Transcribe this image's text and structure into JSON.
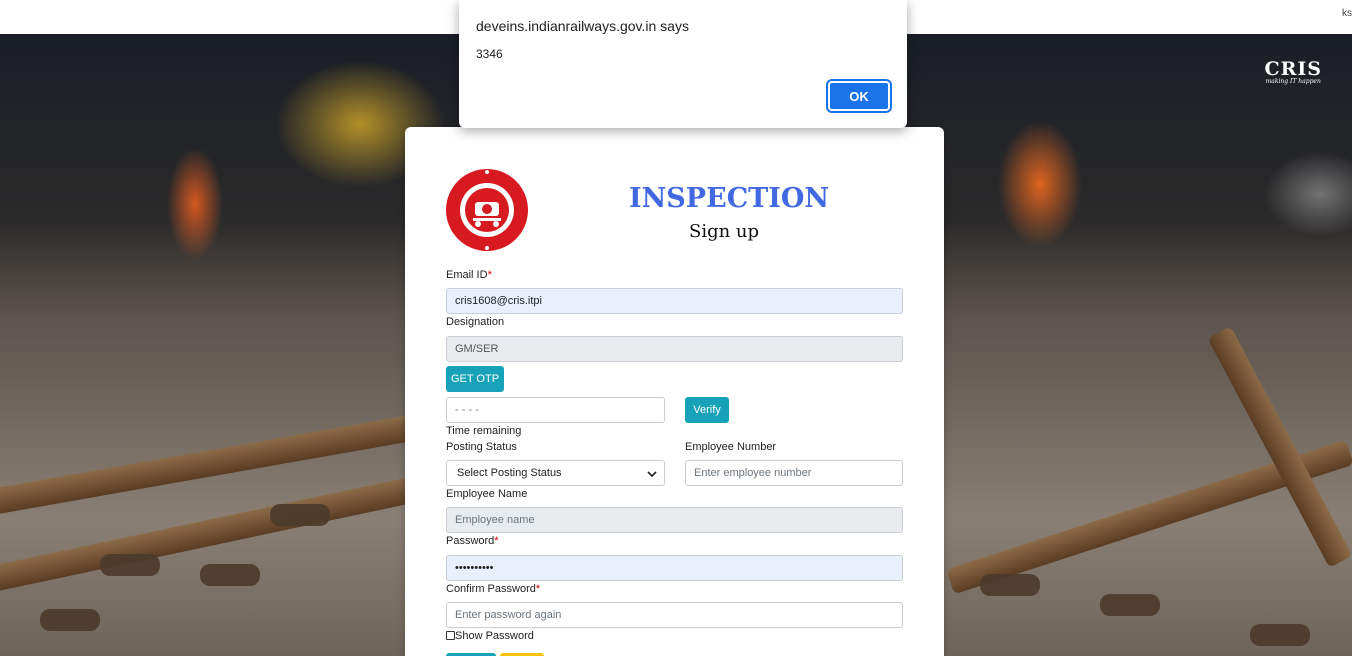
{
  "browser": {
    "edge_text": "ks"
  },
  "dialog": {
    "title": "deveins.indianrailways.gov.in says",
    "message": "3346",
    "ok_label": "OK"
  },
  "logo": {
    "name": "CRIS",
    "tagline": "making IT happen"
  },
  "form": {
    "title": "INSPECTION",
    "subtitle": "Sign up",
    "email": {
      "label": "Email ID",
      "required_mark": "*",
      "value": "cris1608@cris.itpi"
    },
    "designation": {
      "label": "Designation",
      "value": "GM/SER"
    },
    "get_otp_label": "GET OTP",
    "otp": {
      "value": "- - - -"
    },
    "verify_label": "Verify",
    "time_remaining_label": "Time remaining",
    "posting_status": {
      "label": "Posting Status",
      "selected": "Select Posting Status"
    },
    "employee_number": {
      "label": "Employee Number",
      "placeholder": "Enter employee number"
    },
    "employee_name": {
      "label": "Employee Name",
      "placeholder": "Employee name"
    },
    "password": {
      "label": "Password",
      "required_mark": "*",
      "value": "••••••••••"
    },
    "confirm_password": {
      "label": "Confirm Password",
      "required_mark": "*",
      "placeholder": "Enter password again"
    },
    "show_password_label": "Show Password"
  },
  "colors": {
    "title_blue": "#4169e1",
    "teal_button": "#17a2b8",
    "dialog_ok": "#1a73e8",
    "required_red": "#d00000",
    "emblem_red": "#d71920"
  }
}
